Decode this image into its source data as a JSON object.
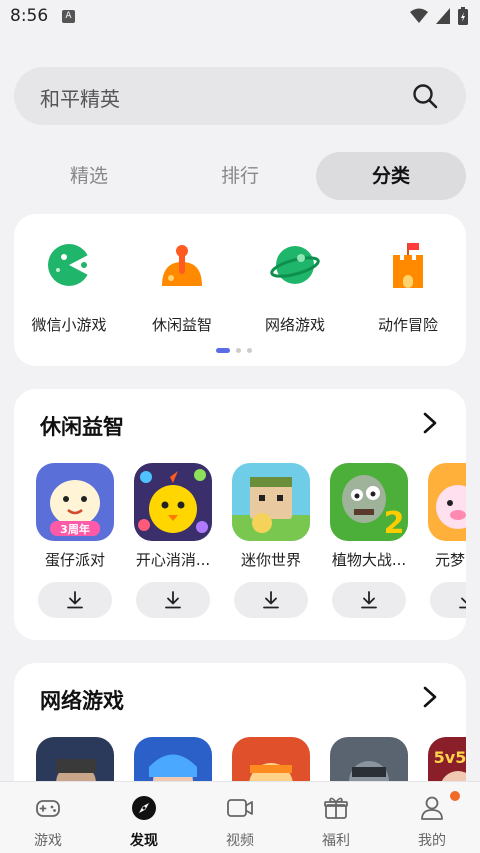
{
  "status": {
    "time": "8:56",
    "badge": "A"
  },
  "search": {
    "query": "和平精英"
  },
  "tabs": [
    {
      "label": "精选",
      "active": false
    },
    {
      "label": "排行",
      "active": false
    },
    {
      "label": "分类",
      "active": true
    }
  ],
  "categories": [
    {
      "label": "微信小游戏",
      "icon": "wechat-minigame-icon"
    },
    {
      "label": "休闲益智",
      "icon": "casual-puzzle-icon"
    },
    {
      "label": "网络游戏",
      "icon": "online-game-icon"
    },
    {
      "label": "动作冒险",
      "icon": "action-adventure-icon"
    }
  ],
  "pager": {
    "pages": 3,
    "current": 1
  },
  "sections": [
    {
      "title": "休闲益智",
      "apps": [
        {
          "name": "蛋仔派对",
          "badge": "3周年"
        },
        {
          "name": "开心消消..."
        },
        {
          "name": "迷你世界"
        },
        {
          "name": "植物大战..."
        },
        {
          "name": "元梦"
        }
      ]
    },
    {
      "title": "网络游戏",
      "apps": [
        {
          "name": ""
        },
        {
          "name": ""
        },
        {
          "name": ""
        },
        {
          "name": ""
        },
        {
          "name": "",
          "badge": "5v5"
        }
      ]
    }
  ],
  "nav": [
    {
      "label": "游戏",
      "icon": "gamepad-icon",
      "active": false
    },
    {
      "label": "发现",
      "icon": "compass-icon",
      "active": true
    },
    {
      "label": "视频",
      "icon": "video-icon",
      "active": false
    },
    {
      "label": "福利",
      "icon": "gift-icon",
      "active": false
    },
    {
      "label": "我的",
      "icon": "person-icon",
      "active": false,
      "notification": true
    }
  ],
  "colors": {
    "accent": "#5a6ce8",
    "badge": "#f06a2a",
    "category_green": "#1fb56a",
    "category_orange": "#ff8a00"
  }
}
